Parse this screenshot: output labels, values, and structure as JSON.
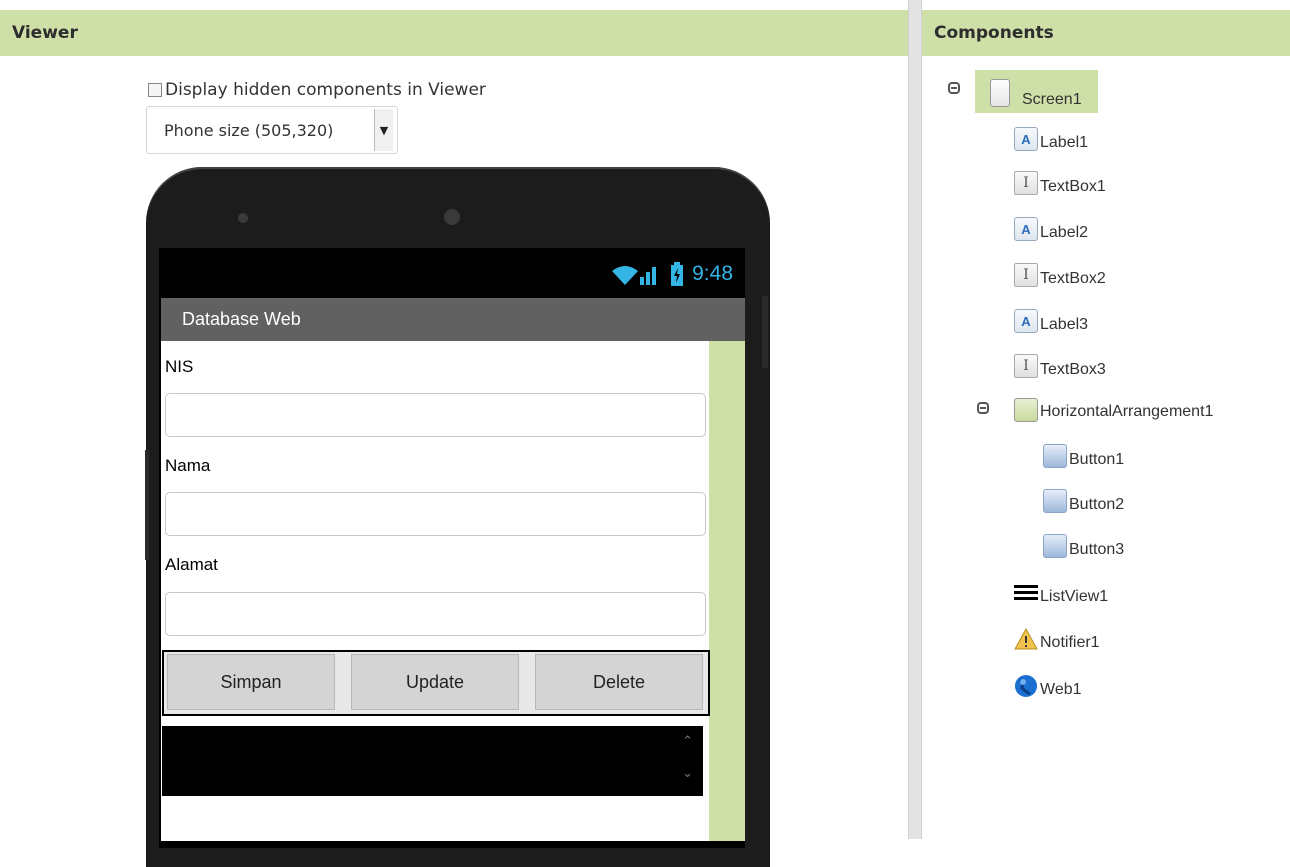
{
  "viewer": {
    "header": "Viewer",
    "hidden_label": "Display hidden components in Viewer",
    "size_value": "Phone size (505,320)"
  },
  "phone": {
    "time": "9:48",
    "app_title": "Database Web",
    "labels": [
      "NIS",
      "Nama",
      "Alamat"
    ],
    "buttons": [
      "Simpan",
      "Update",
      "Delete"
    ]
  },
  "components": {
    "header": "Components",
    "tree": [
      {
        "label": "Screen1",
        "icon": "screen-icon"
      },
      {
        "label": "Label1",
        "icon": "label-icon"
      },
      {
        "label": "TextBox1",
        "icon": "textbox-icon"
      },
      {
        "label": "Label2",
        "icon": "label-icon"
      },
      {
        "label": "TextBox2",
        "icon": "textbox-icon"
      },
      {
        "label": "Label3",
        "icon": "label-icon"
      },
      {
        "label": "TextBox3",
        "icon": "textbox-icon"
      },
      {
        "label": "HorizontalArrangement1",
        "icon": "horizontal-arrangement-icon"
      },
      {
        "label": "Button1",
        "icon": "button-icon"
      },
      {
        "label": "Button2",
        "icon": "button-icon"
      },
      {
        "label": "Button3",
        "icon": "button-icon"
      },
      {
        "label": "ListView1",
        "icon": "listview-icon"
      },
      {
        "label": "Notifier1",
        "icon": "notifier-icon"
      },
      {
        "label": "Web1",
        "icon": "web-icon"
      }
    ]
  },
  "colors": {
    "panel_header": "#cfdfa8",
    "status_icon": "#34b5e5",
    "title_bar": "#616161"
  }
}
